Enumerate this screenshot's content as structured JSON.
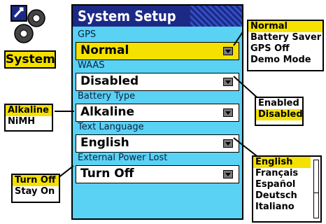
{
  "app_icon": {
    "label": "System",
    "icon": "gears-icon"
  },
  "screen": {
    "title": "System Setup",
    "fields": [
      {
        "label": "GPS",
        "value": "Normal",
        "highlighted": true
      },
      {
        "label": "WAAS",
        "value": "Disabled",
        "highlighted": false
      },
      {
        "label": "Battery Type",
        "value": "Alkaline",
        "highlighted": false
      },
      {
        "label": "Text Language",
        "value": "English",
        "highlighted": false
      },
      {
        "label": "External Power Lost",
        "value": "Turn Off",
        "highlighted": false
      }
    ]
  },
  "callouts": {
    "gps": {
      "options": [
        "Normal",
        "Battery Saver",
        "GPS Off",
        "Demo Mode"
      ],
      "selected": "Normal"
    },
    "waas": {
      "options": [
        "Enabled",
        "Disabled"
      ],
      "selected": "Disabled"
    },
    "battery": {
      "options": [
        "Alkaline",
        "NiMH"
      ],
      "selected": "Alkaline"
    },
    "language": {
      "options": [
        "English",
        "Français",
        "Español",
        "Deutsch",
        "Italiano"
      ],
      "selected": "English"
    },
    "power": {
      "options": [
        "Turn Off",
        "Stay On"
      ],
      "selected": "Turn Off"
    }
  },
  "colors": {
    "title_bar": "#1c2a86",
    "body": "#5ad2f4",
    "highlight": "#f5e100"
  }
}
